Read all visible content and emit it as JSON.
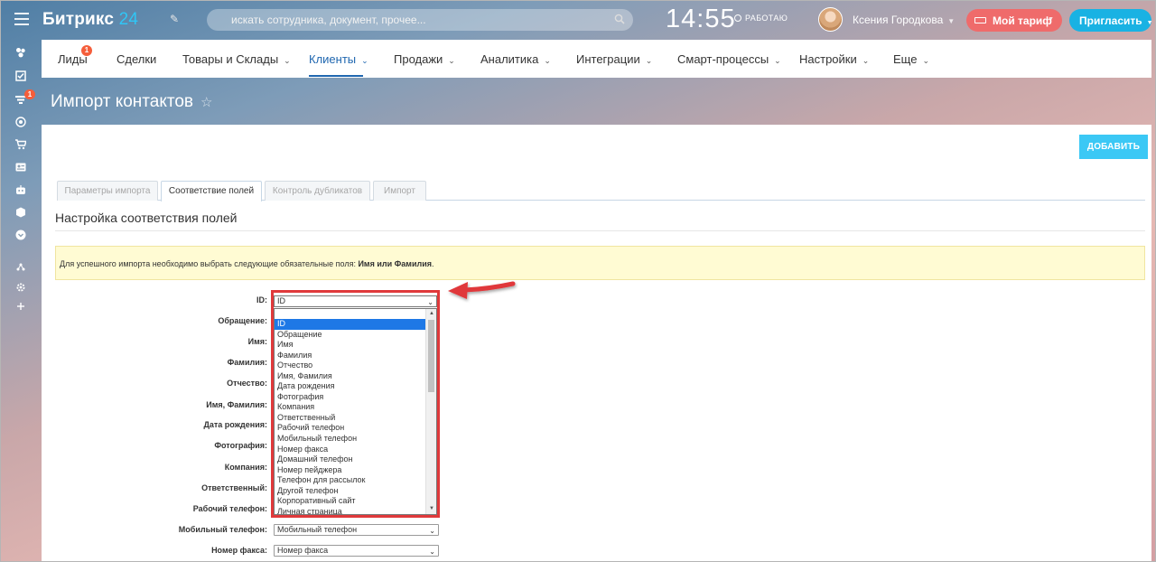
{
  "app": {
    "logo_main": "Битрикс",
    "logo_num": "24",
    "search_placeholder": "искать сотрудника, документ, прочее...",
    "clock": "14:55",
    "work_status": "РАБОТАЮ",
    "user_name": "Ксения Городкова",
    "tariff_label": "Мой тариф",
    "invite_label": "Пригласить"
  },
  "sidebar": {
    "icons": [
      "dashboard-icon",
      "tasks-icon",
      "filter-icon",
      "target-icon",
      "shop-icon",
      "contact-card-icon",
      "robot-icon",
      "box-icon",
      "chevron-circle-icon",
      "sitemap-icon",
      "gear-icon",
      "plus-icon"
    ],
    "filter_badge": "1"
  },
  "menu": {
    "items": [
      {
        "label": "Лиды",
        "dropdown": false,
        "badge": "1"
      },
      {
        "label": "Сделки",
        "dropdown": false
      },
      {
        "label": "Товары и Склады",
        "dropdown": true
      },
      {
        "label": "Клиенты",
        "dropdown": true,
        "active": true
      },
      {
        "label": "Продажи",
        "dropdown": true
      },
      {
        "label": "Аналитика",
        "dropdown": true
      },
      {
        "label": "Интеграции",
        "dropdown": true
      },
      {
        "label": "Смарт-процессы",
        "dropdown": true
      },
      {
        "label": "Настройки",
        "dropdown": true
      },
      {
        "label": "Еще",
        "dropdown": true
      }
    ]
  },
  "page": {
    "title": "Импорт контактов",
    "add_button": "ДОБАВИТЬ",
    "tabs": [
      "Параметры импорта",
      "Соответствие полей",
      "Контроль дубликатов",
      "Импорт"
    ],
    "active_tab": "Соответствие полей",
    "section_title": "Настройка соответствия полей",
    "notice_text": "Для успешного импорта необходимо выбрать следующие обязательные поля: ",
    "notice_bold": "Имя или Фамилия",
    "notice_end": "."
  },
  "fields": [
    {
      "label": "ID:",
      "value": "ID"
    },
    {
      "label": "Обращение:",
      "value": ""
    },
    {
      "label": "Имя:",
      "value": ""
    },
    {
      "label": "Фамилия:",
      "value": ""
    },
    {
      "label": "Отчество:",
      "value": ""
    },
    {
      "label": "Имя, Фамилия:",
      "value": ""
    },
    {
      "label": "Дата рождения:",
      "value": ""
    },
    {
      "label": "Фотография:",
      "value": ""
    },
    {
      "label": "Компания:",
      "value": ""
    },
    {
      "label": "Ответственный:",
      "value": ""
    },
    {
      "label": "Рабочий телефон:",
      "value": ""
    },
    {
      "label": "Мобильный телефон:",
      "value": "Мобильный телефон"
    },
    {
      "label": "Номер факса:",
      "value": "Номер факса"
    }
  ],
  "dropdown": {
    "current": "ID",
    "options": [
      "",
      "ID",
      "Обращение",
      "Имя",
      "Фамилия",
      "Отчество",
      "Имя, Фамилия",
      "Дата рождения",
      "Фотография",
      "Компания",
      "Ответственный",
      "Рабочий телефон",
      "Мобильный телефон",
      "Номер факса",
      "Домашний телефон",
      "Номер пейджера",
      "Телефон для рассылок",
      "Другой телефон",
      "Корпоративный сайт",
      "Личная страница"
    ],
    "selected_option": "ID"
  },
  "colors": {
    "accent_blue": "#2067b0",
    "add_button": "#3bc8f5",
    "invite_button": "#19b2e3",
    "tariff_button": "#ef6b6b",
    "highlight_frame": "#e0393b",
    "notice_bg": "#fffbd3",
    "selected_option_bg": "#1e78e6"
  }
}
